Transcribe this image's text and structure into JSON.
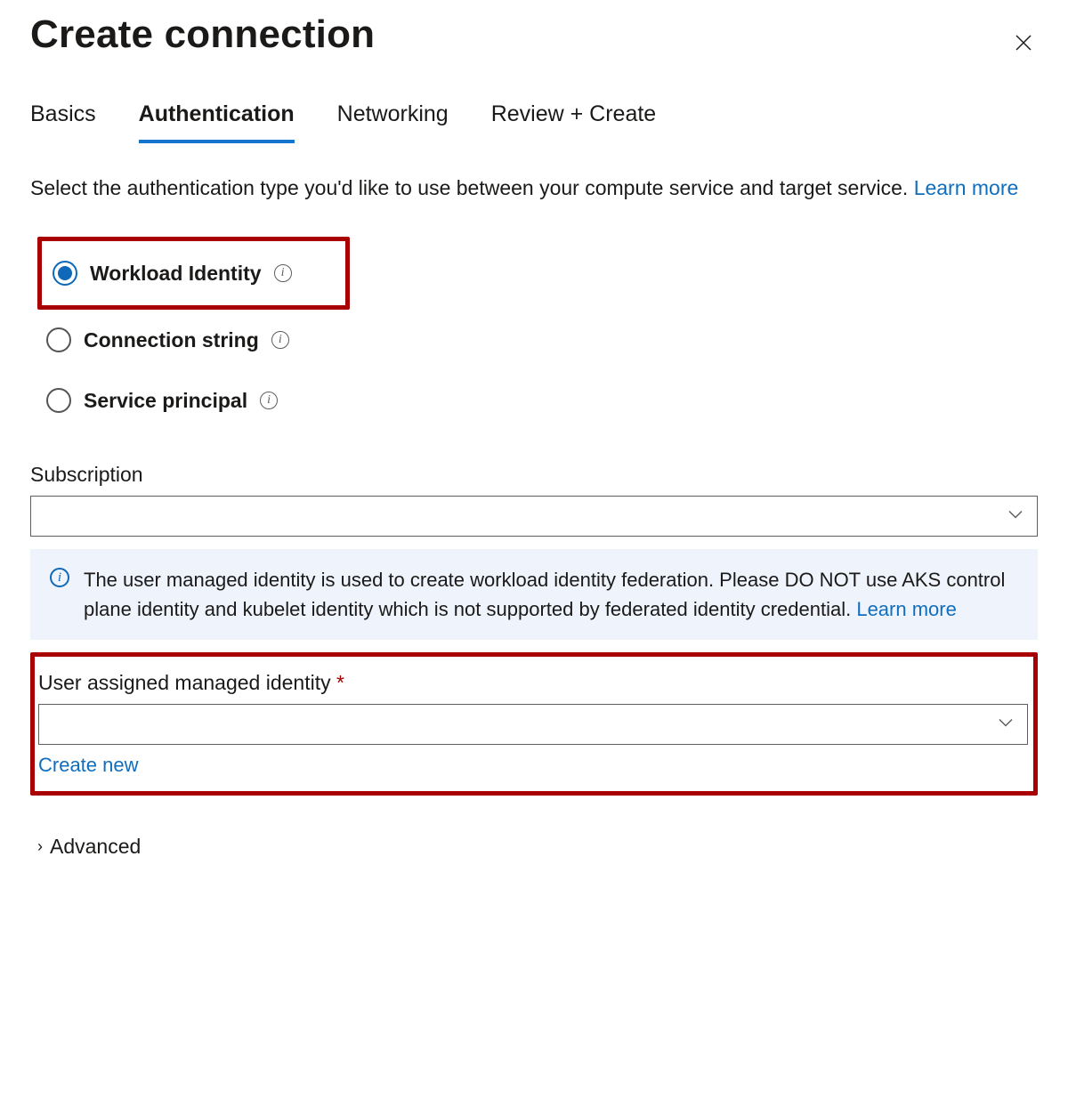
{
  "header": {
    "title": "Create connection"
  },
  "tabs": {
    "basics": "Basics",
    "authentication": "Authentication",
    "networking": "Networking",
    "review": "Review + Create",
    "active": "authentication"
  },
  "intro": {
    "text": "Select the authentication type you'd like to use between your compute service and target service. ",
    "learn_more": "Learn more"
  },
  "auth_type": {
    "workload_identity": "Workload Identity",
    "connection_string": "Connection string",
    "service_principal": "Service principal",
    "selected": "workload_identity"
  },
  "fields": {
    "subscription_label": "Subscription",
    "subscription_value": "",
    "uami_label": "User assigned managed identity",
    "uami_value": "",
    "create_new": "Create new"
  },
  "infobox": {
    "text": "The user managed identity is used to create workload identity federation. Please DO NOT use AKS control plane identity and kubelet identity which is not supported by federated identity credential.  ",
    "learn_more": "Learn more"
  },
  "advanced": {
    "label": "Advanced"
  }
}
